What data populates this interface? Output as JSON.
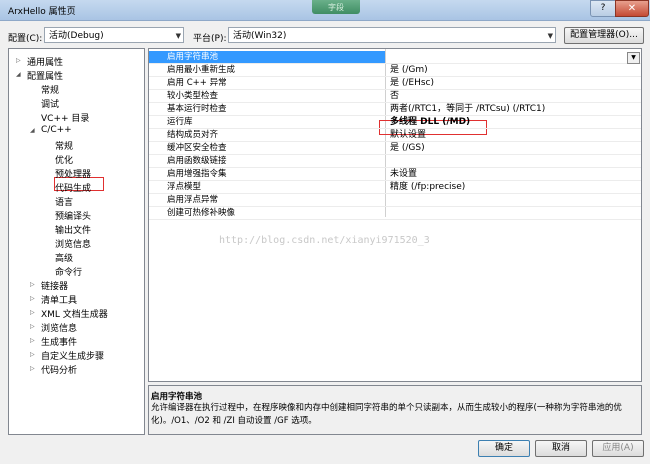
{
  "window": {
    "title": "ArxHello 属性页",
    "glass_text": "字段",
    "help": "?",
    "close": "✕"
  },
  "toolbar": {
    "config_label": "配置(C):",
    "config_value": "活动(Debug)",
    "platform_label": "平台(P):",
    "platform_value": "活动(Win32)",
    "config_manager": "配置管理器(O)..."
  },
  "tree": [
    {
      "label": "通用属性",
      "toggle": "▷"
    },
    {
      "label": "配置属性",
      "toggle": "◢"
    },
    {
      "label": "常规"
    },
    {
      "label": "调试"
    },
    {
      "label": "VC++ 目录"
    },
    {
      "label": "C/C++",
      "toggle": "◢"
    },
    {
      "label": "常规"
    },
    {
      "label": "优化"
    },
    {
      "label": "预处理器"
    },
    {
      "label": "代码生成",
      "selected": true
    },
    {
      "label": "语言"
    },
    {
      "label": "预编译头"
    },
    {
      "label": "输出文件"
    },
    {
      "label": "浏览信息"
    },
    {
      "label": "高级"
    },
    {
      "label": "命令行"
    },
    {
      "label": "链接器",
      "toggle": "▷"
    },
    {
      "label": "清单工具",
      "toggle": "▷"
    },
    {
      "label": "XML 文档生成器",
      "toggle": "▷"
    },
    {
      "label": "浏览信息",
      "toggle": "▷"
    },
    {
      "label": "生成事件",
      "toggle": "▷"
    },
    {
      "label": "自定义生成步骤",
      "toggle": "▷"
    },
    {
      "label": "代码分析",
      "toggle": "▷"
    }
  ],
  "properties": [
    {
      "name": "启用字符串池",
      "value": "",
      "selected": true
    },
    {
      "name": "启用最小重新生成",
      "value": "是 (/Gm)"
    },
    {
      "name": "启用 C++ 异常",
      "value": "是 (/EHsc)"
    },
    {
      "name": "较小类型检查",
      "value": "否"
    },
    {
      "name": "基本运行时检查",
      "value": "两者(/RTC1，等同于 /RTCsu) (/RTC1)"
    },
    {
      "name": "运行库",
      "value": "多线程 DLL (/MD)",
      "bold": true
    },
    {
      "name": "结构成员对齐",
      "value": "默认设置"
    },
    {
      "name": "缓冲区安全检查",
      "value": "是 (/GS)"
    },
    {
      "name": "启用函数级链接",
      "value": ""
    },
    {
      "name": "启用增强指令集",
      "value": "未设置"
    },
    {
      "name": "浮点模型",
      "value": "精度 (/fp:precise)"
    },
    {
      "name": "启用浮点异常",
      "value": ""
    },
    {
      "name": "创建可热修补映像",
      "value": ""
    }
  ],
  "watermark": "http://blog.csdn.net/xianyi971520_3",
  "description": {
    "title": "启用字符串池",
    "text": "允许编译器在执行过程中，在程序映像和内存中创建相同字符串的单个只读副本，从而生成较小的程序(一种称为字符串池的优化)。/O1、/O2 和 /ZI 自动设置 /GF 选项。"
  },
  "buttons": {
    "ok": "确定",
    "cancel": "取消",
    "apply": "应用(A)"
  },
  "colors": {
    "selection": "#3399ff",
    "highlight_box": "#e03030"
  }
}
